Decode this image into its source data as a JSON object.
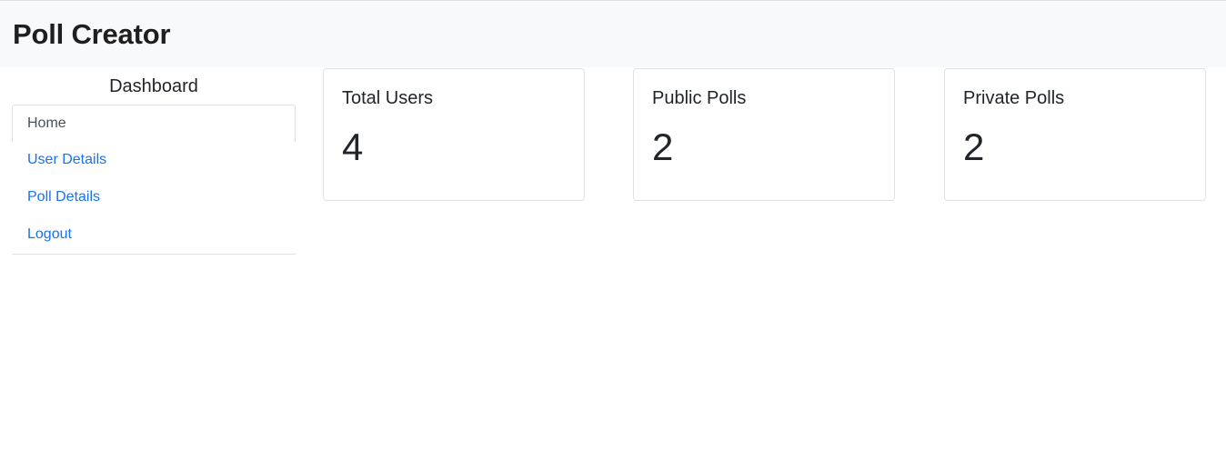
{
  "navbar": {
    "brand": "Poll Creator"
  },
  "sidebar": {
    "title": "Dashboard",
    "items": [
      {
        "label": "Home"
      },
      {
        "label": "User Details"
      },
      {
        "label": "Poll Details"
      },
      {
        "label": "Logout"
      }
    ]
  },
  "stats": [
    {
      "title": "Total Users",
      "value": "4"
    },
    {
      "title": "Public Polls",
      "value": "2"
    },
    {
      "title": "Private Polls",
      "value": "2"
    }
  ],
  "colors": {
    "navbar_bg": "#f8f9fa",
    "link": "#1a73e8",
    "border": "#dee2e6",
    "text": "#212529"
  }
}
